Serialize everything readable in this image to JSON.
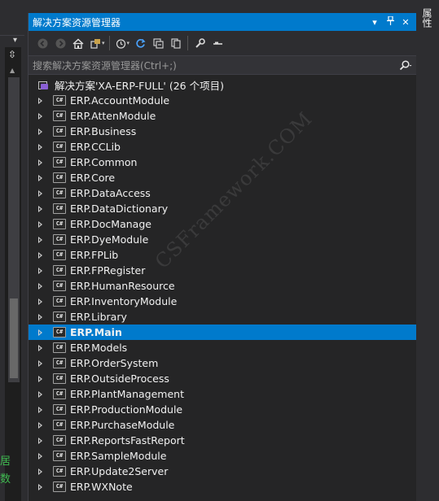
{
  "panel": {
    "title": "解决方案资源管理器",
    "title_buttons": {
      "dropdown": "▾",
      "pin": "⊥",
      "close": "✕"
    }
  },
  "toolbar": {
    "tools": [
      "back-icon",
      "forward-icon",
      "home-icon",
      "switch-views-icon",
      "pending-changes-filter-icon",
      "refresh-icon",
      "collapse-all-icon",
      "show-all-files-icon",
      "properties-icon",
      "preview-icon"
    ]
  },
  "search": {
    "placeholder": "搜索解决方案资源管理器(Ctrl+;)"
  },
  "solution": {
    "label": "解决方案'XA-ERP-FULL' (26 个项目)"
  },
  "projects": [
    {
      "name": "ERP.AccountModule"
    },
    {
      "name": "ERP.AttenModule"
    },
    {
      "name": "ERP.Business"
    },
    {
      "name": "ERP.CCLib"
    },
    {
      "name": "ERP.Common"
    },
    {
      "name": "ERP.Core"
    },
    {
      "name": "ERP.DataAccess"
    },
    {
      "name": "ERP.DataDictionary"
    },
    {
      "name": "ERP.DocManage"
    },
    {
      "name": "ERP.DyeModule"
    },
    {
      "name": "ERP.FPLib"
    },
    {
      "name": "ERP.FPRegister"
    },
    {
      "name": "ERP.HumanResource"
    },
    {
      "name": "ERP.InventoryModule"
    },
    {
      "name": "ERP.Library"
    },
    {
      "name": "ERP.Main",
      "selected": true
    },
    {
      "name": "ERP.Models"
    },
    {
      "name": "ERP.OrderSystem"
    },
    {
      "name": "ERP.OutsideProcess"
    },
    {
      "name": "ERP.PlantManagement"
    },
    {
      "name": "ERP.ProductionModule"
    },
    {
      "name": "ERP.PurchaseModule"
    },
    {
      "name": "ERP.ReportsFastReport"
    },
    {
      "name": "ERP.SampleModule"
    },
    {
      "name": "ERP.Update2Server"
    },
    {
      "name": "ERP.WXNote"
    }
  ],
  "project_icon_text": "C#",
  "right_tab": "属性",
  "left_strip": {
    "green_a": "居",
    "green_b": "数"
  },
  "watermark": "CSFramework.COM",
  "colors": {
    "accent": "#007acc",
    "background": "#252526",
    "toolbar": "#2d2d30",
    "text": "#f1f1f1"
  }
}
